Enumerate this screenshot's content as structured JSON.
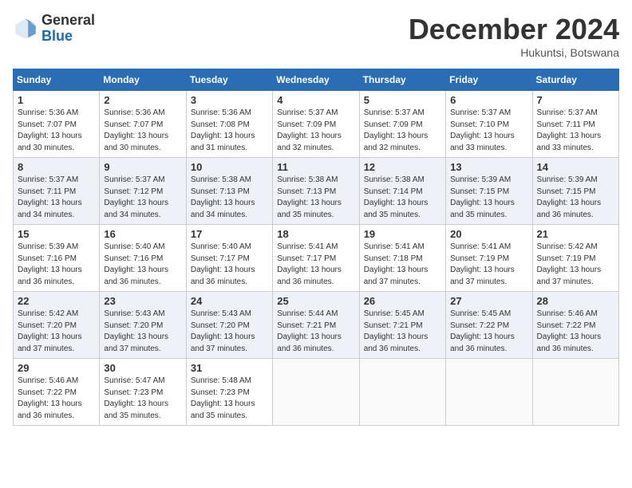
{
  "header": {
    "logo_line1": "General",
    "logo_line2": "Blue",
    "month_title": "December 2024",
    "location": "Hukuntsi, Botswana"
  },
  "weekdays": [
    "Sunday",
    "Monday",
    "Tuesday",
    "Wednesday",
    "Thursday",
    "Friday",
    "Saturday"
  ],
  "weeks": [
    [
      {
        "day": "1",
        "info": "Sunrise: 5:36 AM\nSunset: 7:07 PM\nDaylight: 13 hours\nand 30 minutes."
      },
      {
        "day": "2",
        "info": "Sunrise: 5:36 AM\nSunset: 7:07 PM\nDaylight: 13 hours\nand 30 minutes."
      },
      {
        "day": "3",
        "info": "Sunrise: 5:36 AM\nSunset: 7:08 PM\nDaylight: 13 hours\nand 31 minutes."
      },
      {
        "day": "4",
        "info": "Sunrise: 5:37 AM\nSunset: 7:09 PM\nDaylight: 13 hours\nand 32 minutes."
      },
      {
        "day": "5",
        "info": "Sunrise: 5:37 AM\nSunset: 7:09 PM\nDaylight: 13 hours\nand 32 minutes."
      },
      {
        "day": "6",
        "info": "Sunrise: 5:37 AM\nSunset: 7:10 PM\nDaylight: 13 hours\nand 33 minutes."
      },
      {
        "day": "7",
        "info": "Sunrise: 5:37 AM\nSunset: 7:11 PM\nDaylight: 13 hours\nand 33 minutes."
      }
    ],
    [
      {
        "day": "8",
        "info": "Sunrise: 5:37 AM\nSunset: 7:11 PM\nDaylight: 13 hours\nand 34 minutes."
      },
      {
        "day": "9",
        "info": "Sunrise: 5:37 AM\nSunset: 7:12 PM\nDaylight: 13 hours\nand 34 minutes."
      },
      {
        "day": "10",
        "info": "Sunrise: 5:38 AM\nSunset: 7:13 PM\nDaylight: 13 hours\nand 34 minutes."
      },
      {
        "day": "11",
        "info": "Sunrise: 5:38 AM\nSunset: 7:13 PM\nDaylight: 13 hours\nand 35 minutes."
      },
      {
        "day": "12",
        "info": "Sunrise: 5:38 AM\nSunset: 7:14 PM\nDaylight: 13 hours\nand 35 minutes."
      },
      {
        "day": "13",
        "info": "Sunrise: 5:39 AM\nSunset: 7:15 PM\nDaylight: 13 hours\nand 35 minutes."
      },
      {
        "day": "14",
        "info": "Sunrise: 5:39 AM\nSunset: 7:15 PM\nDaylight: 13 hours\nand 36 minutes."
      }
    ],
    [
      {
        "day": "15",
        "info": "Sunrise: 5:39 AM\nSunset: 7:16 PM\nDaylight: 13 hours\nand 36 minutes."
      },
      {
        "day": "16",
        "info": "Sunrise: 5:40 AM\nSunset: 7:16 PM\nDaylight: 13 hours\nand 36 minutes."
      },
      {
        "day": "17",
        "info": "Sunrise: 5:40 AM\nSunset: 7:17 PM\nDaylight: 13 hours\nand 36 minutes."
      },
      {
        "day": "18",
        "info": "Sunrise: 5:41 AM\nSunset: 7:17 PM\nDaylight: 13 hours\nand 36 minutes."
      },
      {
        "day": "19",
        "info": "Sunrise: 5:41 AM\nSunset: 7:18 PM\nDaylight: 13 hours\nand 37 minutes."
      },
      {
        "day": "20",
        "info": "Sunrise: 5:41 AM\nSunset: 7:19 PM\nDaylight: 13 hours\nand 37 minutes."
      },
      {
        "day": "21",
        "info": "Sunrise: 5:42 AM\nSunset: 7:19 PM\nDaylight: 13 hours\nand 37 minutes."
      }
    ],
    [
      {
        "day": "22",
        "info": "Sunrise: 5:42 AM\nSunset: 7:20 PM\nDaylight: 13 hours\nand 37 minutes."
      },
      {
        "day": "23",
        "info": "Sunrise: 5:43 AM\nSunset: 7:20 PM\nDaylight: 13 hours\nand 37 minutes."
      },
      {
        "day": "24",
        "info": "Sunrise: 5:43 AM\nSunset: 7:20 PM\nDaylight: 13 hours\nand 37 minutes."
      },
      {
        "day": "25",
        "info": "Sunrise: 5:44 AM\nSunset: 7:21 PM\nDaylight: 13 hours\nand 36 minutes."
      },
      {
        "day": "26",
        "info": "Sunrise: 5:45 AM\nSunset: 7:21 PM\nDaylight: 13 hours\nand 36 minutes."
      },
      {
        "day": "27",
        "info": "Sunrise: 5:45 AM\nSunset: 7:22 PM\nDaylight: 13 hours\nand 36 minutes."
      },
      {
        "day": "28",
        "info": "Sunrise: 5:46 AM\nSunset: 7:22 PM\nDaylight: 13 hours\nand 36 minutes."
      }
    ],
    [
      {
        "day": "29",
        "info": "Sunrise: 5:46 AM\nSunset: 7:22 PM\nDaylight: 13 hours\nand 36 minutes."
      },
      {
        "day": "30",
        "info": "Sunrise: 5:47 AM\nSunset: 7:23 PM\nDaylight: 13 hours\nand 35 minutes."
      },
      {
        "day": "31",
        "info": "Sunrise: 5:48 AM\nSunset: 7:23 PM\nDaylight: 13 hours\nand 35 minutes."
      },
      {
        "day": "",
        "info": ""
      },
      {
        "day": "",
        "info": ""
      },
      {
        "day": "",
        "info": ""
      },
      {
        "day": "",
        "info": ""
      }
    ]
  ]
}
